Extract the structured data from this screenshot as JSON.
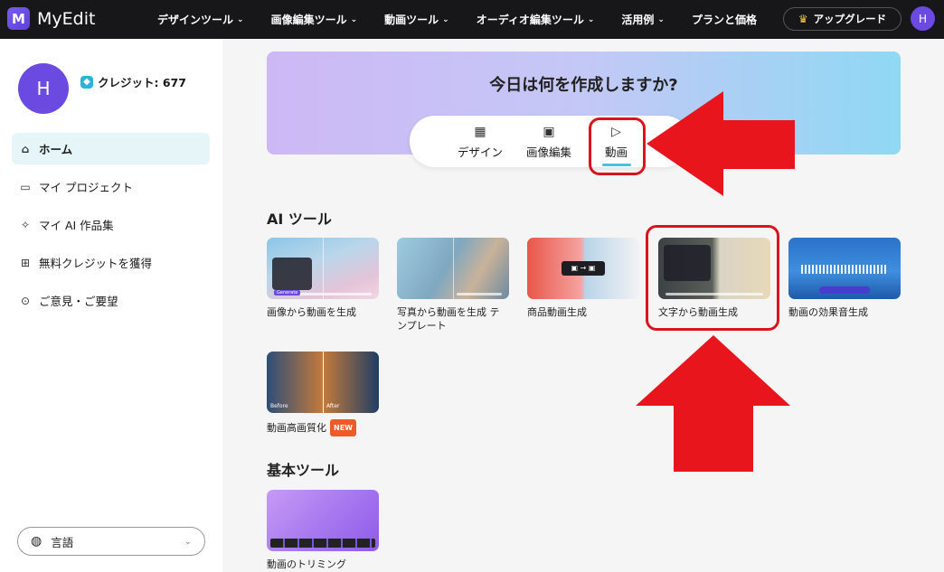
{
  "header": {
    "logo_text": "MyEdit",
    "nav": [
      {
        "label": "デザインツール",
        "icon": "chevron-down-icon"
      },
      {
        "label": "画像編集ツール",
        "icon": "chevron-down-icon"
      },
      {
        "label": "動画ツール",
        "icon": "chevron-down-icon"
      },
      {
        "label": "オーディオ編集ツール",
        "icon": "chevron-down-icon"
      },
      {
        "label": "活用例",
        "icon": "chevron-down-icon"
      },
      {
        "label": "プランと価格"
      }
    ],
    "upgrade_label": "アップグレード",
    "avatar_initial": "H"
  },
  "sidebar": {
    "avatar_initial": "H",
    "credit_label": "クレジット: 677",
    "items": [
      {
        "label": "ホーム",
        "icon": "home-icon",
        "active": true
      },
      {
        "label": "マイ プロジェクト",
        "icon": "folder-icon"
      },
      {
        "label": "マイ AI 作品集",
        "icon": "sparkle-icon"
      },
      {
        "label": "無料クレジットを獲得",
        "icon": "gift-icon"
      },
      {
        "label": "ご意見・ご要望",
        "icon": "feedback-icon"
      }
    ],
    "language_label": "言語"
  },
  "banner": {
    "title": "今日は何を作成しますか?",
    "tabs": [
      {
        "label": "デザイン",
        "icon": "design-icon"
      },
      {
        "label": "画像編集",
        "icon": "image-icon"
      },
      {
        "label": "動画",
        "icon": "video-icon",
        "active": true
      }
    ]
  },
  "sections": {
    "ai_tools_title": "AI ツール",
    "ai_tools": [
      {
        "label": "画像から動画を生成"
      },
      {
        "label": "写真から動画を生成 テンプレート"
      },
      {
        "label": "商品動画生成"
      },
      {
        "label": "文字から動画生成"
      },
      {
        "label": "動画の効果音生成"
      },
      {
        "label": "動画高画質化",
        "badge": "NEW"
      }
    ],
    "basic_tools_title": "基本ツール",
    "basic_tools": [
      {
        "label": "動画のトリミング"
      }
    ]
  },
  "thumb_text": {
    "generate": "Generate",
    "before": "Before",
    "after": "After"
  },
  "colors": {
    "accent": "#6a4ae0",
    "annotation_red": "#d8141c",
    "active_tab_underline": "#4cc2d8"
  }
}
